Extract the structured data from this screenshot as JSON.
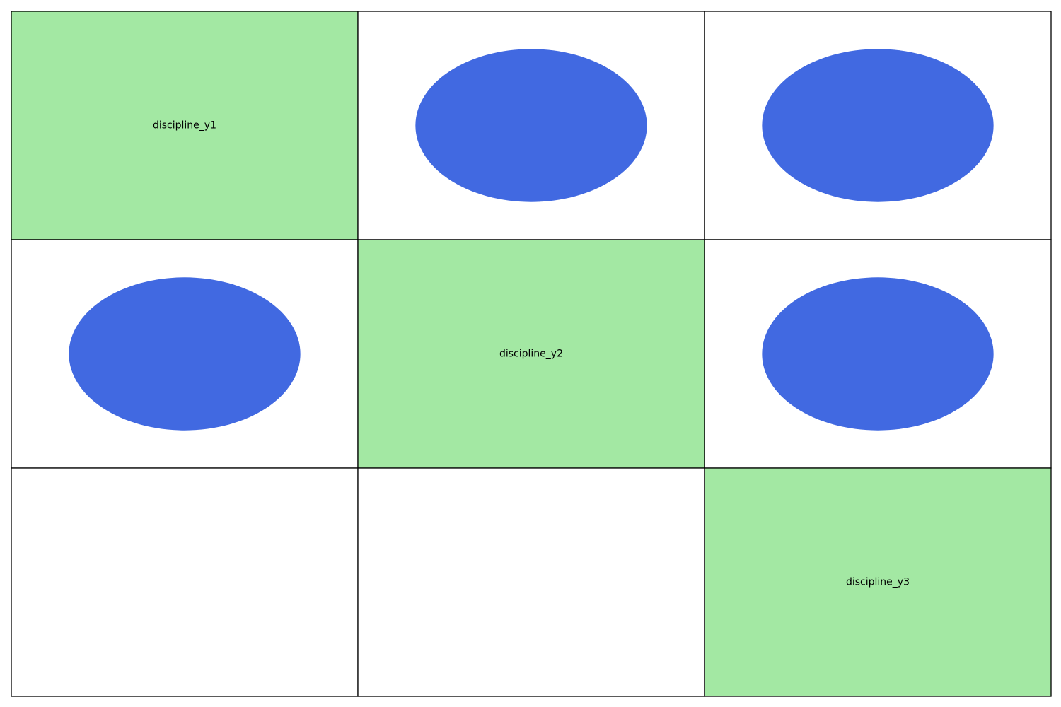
{
  "disciplines": [
    {
      "id": "y1",
      "label": "discipline_y1"
    },
    {
      "id": "y2",
      "label": "discipline_y2"
    },
    {
      "id": "y3",
      "label": "discipline_y3"
    }
  ],
  "couplings": [
    {
      "from": 0,
      "to": 1
    },
    {
      "from": 0,
      "to": 2
    },
    {
      "from": 1,
      "to": 0
    },
    {
      "from": 1,
      "to": 2
    }
  ],
  "colors": {
    "diagonal": "#a3e8a3",
    "coupling": "#4169e1",
    "border": "#000000",
    "empty": "#ffffff"
  }
}
